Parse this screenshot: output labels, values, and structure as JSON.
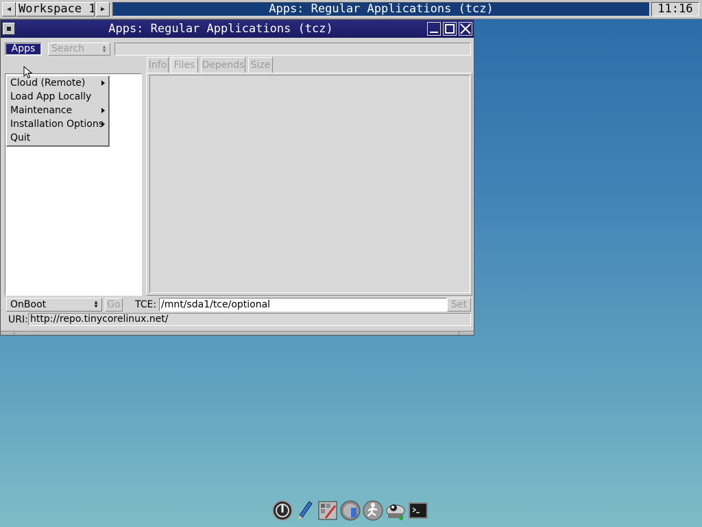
{
  "taskbar": {
    "prev_label": "◀",
    "workspace": "Workspace 1",
    "next_label": "▶",
    "active_task": "Apps: Regular Applications (tcz)",
    "clock": "11:16"
  },
  "window": {
    "title": "Apps: Regular Applications (tcz)",
    "toolbar": {
      "apps_menu": "Apps",
      "search_select": "Search",
      "search_value": ""
    },
    "tabs": [
      {
        "label": "Info"
      },
      {
        "label": "Files"
      },
      {
        "label": "Depends"
      },
      {
        "label": "Size"
      }
    ],
    "active_tab": "Files",
    "bottom": {
      "install_mode": "OnBoot",
      "go_label": "Go",
      "tce_label": "TCE:",
      "tce_path": "/mnt/sda1/tce/optional",
      "set_label": "Set",
      "uri_label": "URI:",
      "uri_value": "http://repo.tinycorelinux.net/"
    }
  },
  "apps_menu_items": [
    {
      "label": "Cloud (Remote)",
      "submenu": true
    },
    {
      "label": "Load App Locally",
      "submenu": false
    },
    {
      "label": "Maintenance",
      "submenu": true
    },
    {
      "label": "Installation Options",
      "submenu": true
    },
    {
      "label": "Quit",
      "submenu": false
    }
  ],
  "dock": [
    {
      "icon": "exit-icon"
    },
    {
      "icon": "editor-icon"
    },
    {
      "icon": "control-panel-icon"
    },
    {
      "icon": "apps-icon"
    },
    {
      "icon": "mount-tool-icon"
    },
    {
      "icon": "tc-install-icon"
    },
    {
      "icon": "terminal-icon"
    }
  ],
  "colors": {
    "titlebar": "#1e1e6e",
    "menu_highlight": "#1e1e78",
    "disabled_text": "#9a9a9a",
    "desktop_top": "#2a6aa6",
    "desktop_bottom": "#7dbdc7"
  }
}
